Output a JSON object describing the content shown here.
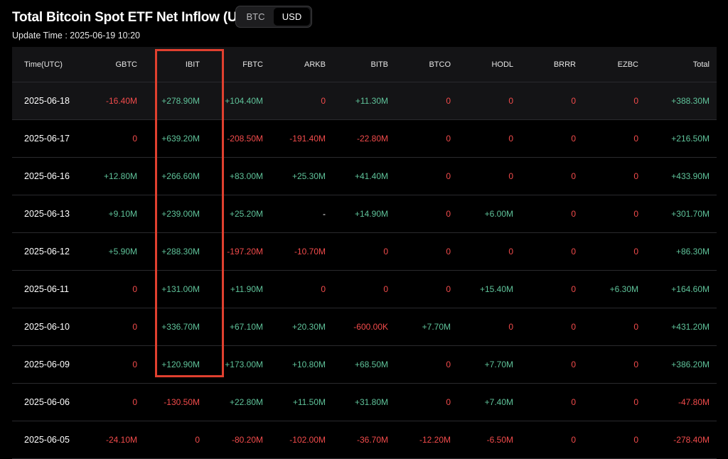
{
  "title": "Total Bitcoin Spot ETF Net Inflow (USD)",
  "toggle": {
    "options": [
      "BTC",
      "USD"
    ],
    "selected": "USD"
  },
  "update_time": "Update Time : 2025-06-19 10:20",
  "colors": {
    "positive": "#5fc39a",
    "negative": "#f24b4b",
    "highlight": "#e0402f"
  },
  "table": {
    "columns": [
      "Time(UTC)",
      "GBTC",
      "IBIT",
      "FBTC",
      "ARKB",
      "BITB",
      "BTCO",
      "HODL",
      "BRRR",
      "EZBC",
      "Total"
    ],
    "rows": [
      [
        "2025-06-18",
        "-16.40M",
        "+278.90M",
        "+104.40M",
        "0",
        "+11.30M",
        "0",
        "0",
        "0",
        "0",
        "+388.30M"
      ],
      [
        "2025-06-17",
        "0",
        "+639.20M",
        "-208.50M",
        "-191.40M",
        "-22.80M",
        "0",
        "0",
        "0",
        "0",
        "+216.50M"
      ],
      [
        "2025-06-16",
        "+12.80M",
        "+266.60M",
        "+83.00M",
        "+25.30M",
        "+41.40M",
        "0",
        "0",
        "0",
        "0",
        "+433.90M"
      ],
      [
        "2025-06-13",
        "+9.10M",
        "+239.00M",
        "+25.20M",
        "-",
        "+14.90M",
        "0",
        "+6.00M",
        "0",
        "0",
        "+301.70M"
      ],
      [
        "2025-06-12",
        "+5.90M",
        "+288.30M",
        "-197.20M",
        "-10.70M",
        "0",
        "0",
        "0",
        "0",
        "0",
        "+86.30M"
      ],
      [
        "2025-06-11",
        "0",
        "+131.00M",
        "+11.90M",
        "0",
        "0",
        "0",
        "+15.40M",
        "0",
        "+6.30M",
        "+164.60M"
      ],
      [
        "2025-06-10",
        "0",
        "+336.70M",
        "+67.10M",
        "+20.30M",
        "-600.00K",
        "+7.70M",
        "0",
        "0",
        "0",
        "+431.20M"
      ],
      [
        "2025-06-09",
        "0",
        "+120.90M",
        "+173.00M",
        "+10.80M",
        "+68.50M",
        "0",
        "+7.70M",
        "0",
        "0",
        "+386.20M"
      ],
      [
        "2025-06-06",
        "0",
        "-130.50M",
        "+22.80M",
        "+11.50M",
        "+31.80M",
        "0",
        "+7.40M",
        "0",
        "0",
        "-47.80M"
      ],
      [
        "2025-06-05",
        "-24.10M",
        "0",
        "-80.20M",
        "-102.00M",
        "-36.70M",
        "-12.20M",
        "-6.50M",
        "0",
        "0",
        "-278.40M"
      ]
    ]
  }
}
